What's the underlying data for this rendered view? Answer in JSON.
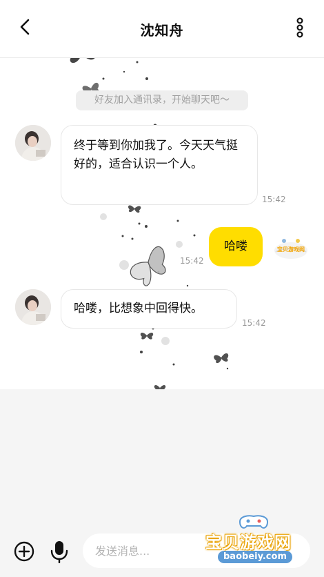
{
  "header": {
    "title": "沈知舟",
    "back_icon": "chevron-left-icon",
    "more_icon": "more-vertical-icon"
  },
  "system_notice": "好友加入通讯录，开始聊天吧～",
  "messages": [
    {
      "sender": "contact",
      "text": "终于等到你加我了。今天天气挺好的，适合认识一个人。",
      "time": "15:42"
    },
    {
      "sender": "self",
      "text": "哈喽",
      "time": "15:42"
    },
    {
      "sender": "contact",
      "text": "哈喽，比想象中回得快。",
      "time": "15:42"
    }
  ],
  "input_bar": {
    "placeholder": "发送消息...",
    "value": "",
    "plus_icon": "plus-circle-icon",
    "mic_icon": "microphone-icon"
  },
  "watermark": {
    "text": "宝贝游戏网",
    "url": "baobeiy.com"
  },
  "colors": {
    "self_bubble": "#ffdd00",
    "contact_bubble": "#ffffff",
    "time_text": "#999999",
    "background": "#f5f5f5"
  }
}
